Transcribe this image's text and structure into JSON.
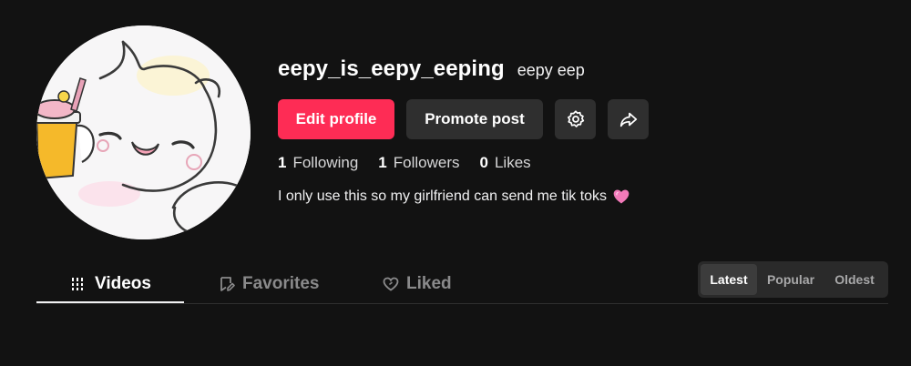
{
  "profile": {
    "username": "eepy_is_eepy_eeping",
    "nickname": "eepy eep",
    "avatar_icon": "cartoon-cat-avatar-icon",
    "bio": "I only use this so my girlfriend can send me tik toks",
    "bio_emoji_icon": "pink-heart-icon"
  },
  "actions": {
    "edit_profile": "Edit profile",
    "promote_post": "Promote post",
    "settings_icon": "gear-icon",
    "share_icon": "share-arrow-icon"
  },
  "stats": [
    {
      "value": "1",
      "label": "Following"
    },
    {
      "value": "1",
      "label": "Followers"
    },
    {
      "value": "0",
      "label": "Likes"
    }
  ],
  "tabs": [
    {
      "label": "Videos",
      "icon": "grid-bars-icon",
      "active": true
    },
    {
      "label": "Favorites",
      "icon": "bookmark-edit-icon",
      "active": false
    },
    {
      "label": "Liked",
      "icon": "heart-outline-icon",
      "active": false
    }
  ],
  "sort": {
    "options": [
      "Latest",
      "Popular",
      "Oldest"
    ],
    "selected": "Latest"
  },
  "colors": {
    "background": "#121212",
    "primary": "#fe2c55",
    "secondary_button": "#2f2f2f",
    "heart": "#f27ab9"
  }
}
